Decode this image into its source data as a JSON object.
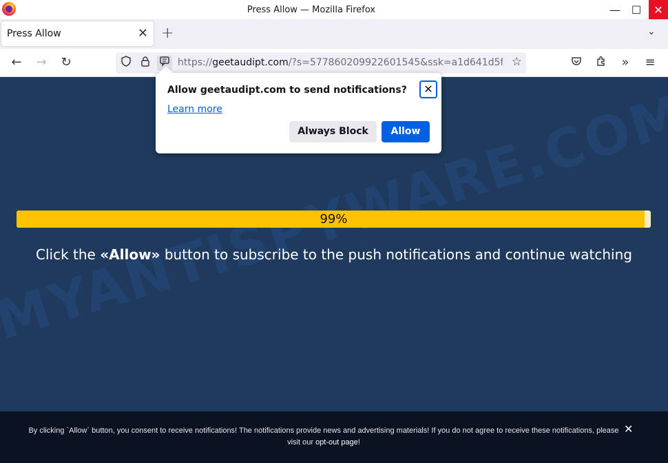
{
  "window": {
    "title": "Press Allow — Mozilla Firefox",
    "controls": {
      "minimize": "—",
      "maximize": "☐",
      "close": "✕"
    }
  },
  "tabs": [
    {
      "title": "Press Allow",
      "close": "✕"
    }
  ],
  "tabstrip": {
    "new_tab": "+",
    "list_tabs": "⌄"
  },
  "navbar": {
    "back": "←",
    "forward": "→",
    "reload": "↻",
    "url_scheme": "https://",
    "url_host": "geetaudipt.com",
    "url_rest": "/?s=577860209922601545&ssk=a1d641d5f",
    "icons": [
      "shield-icon",
      "lock-icon",
      "notification-permission-icon",
      "star-icon",
      "pocket-icon",
      "extensions-icon",
      "overflow-icon",
      "menu-icon"
    ]
  },
  "popup": {
    "title": "Allow geetaudipt.com to send notifications?",
    "learn_more": "Learn more",
    "close": "✕",
    "always_block": "Always Block",
    "allow": "Allow"
  },
  "page": {
    "background": "#1f3a5c",
    "progress_label": "99%",
    "progress_value": 0.99,
    "headline_before": "Click the ",
    "headline_bold": "«Allow»",
    "headline_after": " button to subscribe to the push notifications and continue watching",
    "watermark": "MYANTISPYWARE.COM"
  },
  "consent": {
    "text_before": "By clicking `Allow` button, you consent to receive notifications! The notifications provide news and advertising materials! If you do not agree to receive these notifications, please visit our ",
    "link": "opt-out page",
    "text_after": "!",
    "close": "✕"
  },
  "colors": {
    "accent": "#0061e0",
    "progress": "#ffc200",
    "close_red": "#e81123"
  }
}
